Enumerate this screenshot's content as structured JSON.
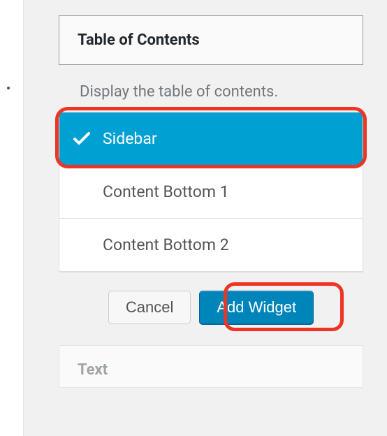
{
  "widget": {
    "title": "Table of Contents",
    "description": "Display the table of contents."
  },
  "options": [
    {
      "label": "Sidebar",
      "selected": true
    },
    {
      "label": "Content Bottom 1",
      "selected": false
    },
    {
      "label": "Content Bottom 2",
      "selected": false
    }
  ],
  "actions": {
    "cancel": "Cancel",
    "add": "Add Widget"
  },
  "nextWidget": {
    "title": "Text"
  }
}
